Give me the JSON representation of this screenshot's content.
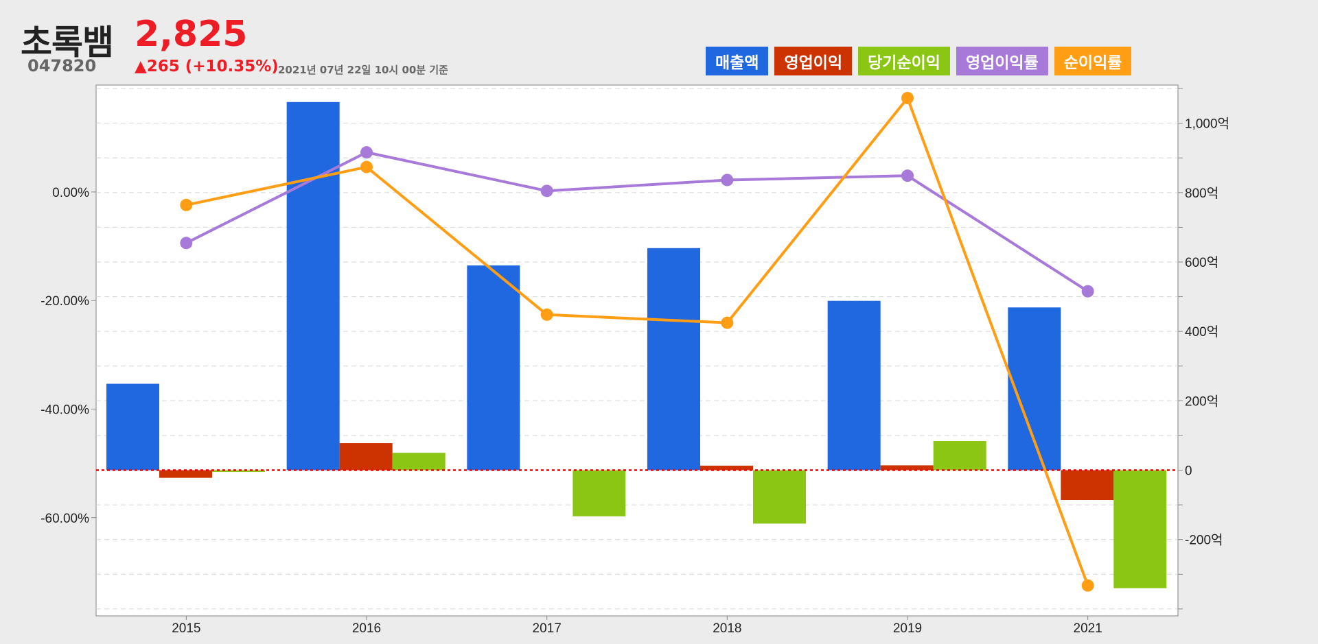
{
  "header": {
    "name": "초록뱀",
    "price": "2,825",
    "code": "047820",
    "change": "▲265 (+10.35%)",
    "timestamp": "2021년 07년 22일 10시 00분 기준"
  },
  "colors": {
    "sales": "#1f68e0",
    "operating_profit": "#cc3300",
    "net_income": "#8bc614",
    "operating_margin": "#a77ad9",
    "net_margin": "#ff9e14",
    "zero_line": "#ee0000",
    "grid": "#d6d6d6"
  },
  "chart_data": {
    "type": "bar",
    "categories": [
      "2015",
      "2016",
      "2017",
      "2018",
      "2019",
      "2021"
    ],
    "series": [
      {
        "name": "매출액",
        "kind": "bar",
        "axis": "right",
        "values": [
          249,
          1061,
          590,
          640,
          488,
          469
        ]
      },
      {
        "name": "영업이익",
        "kind": "bar",
        "axis": "right",
        "values": [
          -22,
          78,
          0,
          13,
          14,
          -86
        ]
      },
      {
        "name": "당기순이익",
        "kind": "bar",
        "axis": "right",
        "values": [
          -5,
          50,
          -133,
          -154,
          84,
          -340
        ]
      },
      {
        "name": "영업이익률",
        "kind": "line",
        "axis": "left",
        "values": [
          -9.4,
          7.3,
          0.2,
          2.2,
          3.0,
          -18.3
        ]
      },
      {
        "name": "순이익률",
        "kind": "line",
        "axis": "left",
        "values": [
          -2.4,
          4.6,
          -22.6,
          -24.1,
          17.3,
          -72.5
        ]
      }
    ],
    "left_axis": {
      "min": -78.1,
      "max": 19.7,
      "ticks": [
        {
          "v": 0,
          "label": "0.00%"
        },
        {
          "v": -20,
          "label": "-20.00%"
        },
        {
          "v": -40,
          "label": "-40.00%"
        },
        {
          "v": -60,
          "label": "-60.00%"
        }
      ]
    },
    "right_axis": {
      "min": -420,
      "max": 1110,
      "ticks": [
        {
          "v": 1000,
          "label": "1,000억"
        },
        {
          "v": 800,
          "label": "800억"
        },
        {
          "v": 600,
          "label": "600억"
        },
        {
          "v": 400,
          "label": "400억"
        },
        {
          "v": 200,
          "label": "200억"
        },
        {
          "v": 0,
          "label": "0"
        },
        {
          "v": -200,
          "label": "-200억"
        }
      ]
    },
    "grid": true,
    "legend_position": "top-right"
  }
}
